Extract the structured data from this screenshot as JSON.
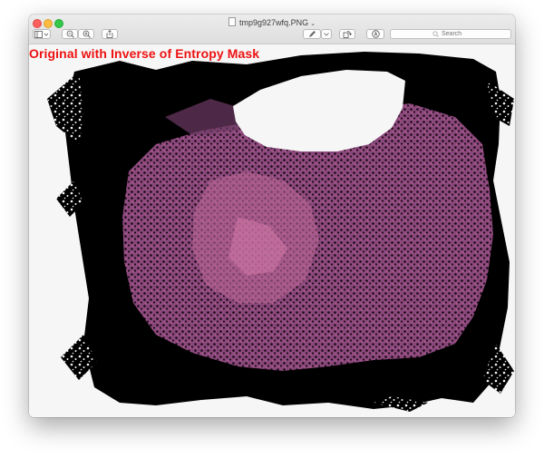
{
  "window": {
    "title": "tmp9g927wfq.PNG",
    "title_chevron": "⌄"
  },
  "toolbar": {
    "sidebar_icon": "sidebar-toggle-icon",
    "zoom_out_icon": "zoom-out-icon",
    "zoom_in_icon": "zoom-in-icon",
    "share_icon": "share-icon",
    "markup_icon": "pen-icon",
    "rotate_icon": "rotate-icon",
    "annotate_icon": "markup-circle-icon",
    "search_placeholder": "Search"
  },
  "image": {
    "caption": "Original with Inverse of Entropy Mask",
    "caption_color": "#ee1111",
    "tissue_color": "#b35a92",
    "mask_color": "#000000"
  }
}
